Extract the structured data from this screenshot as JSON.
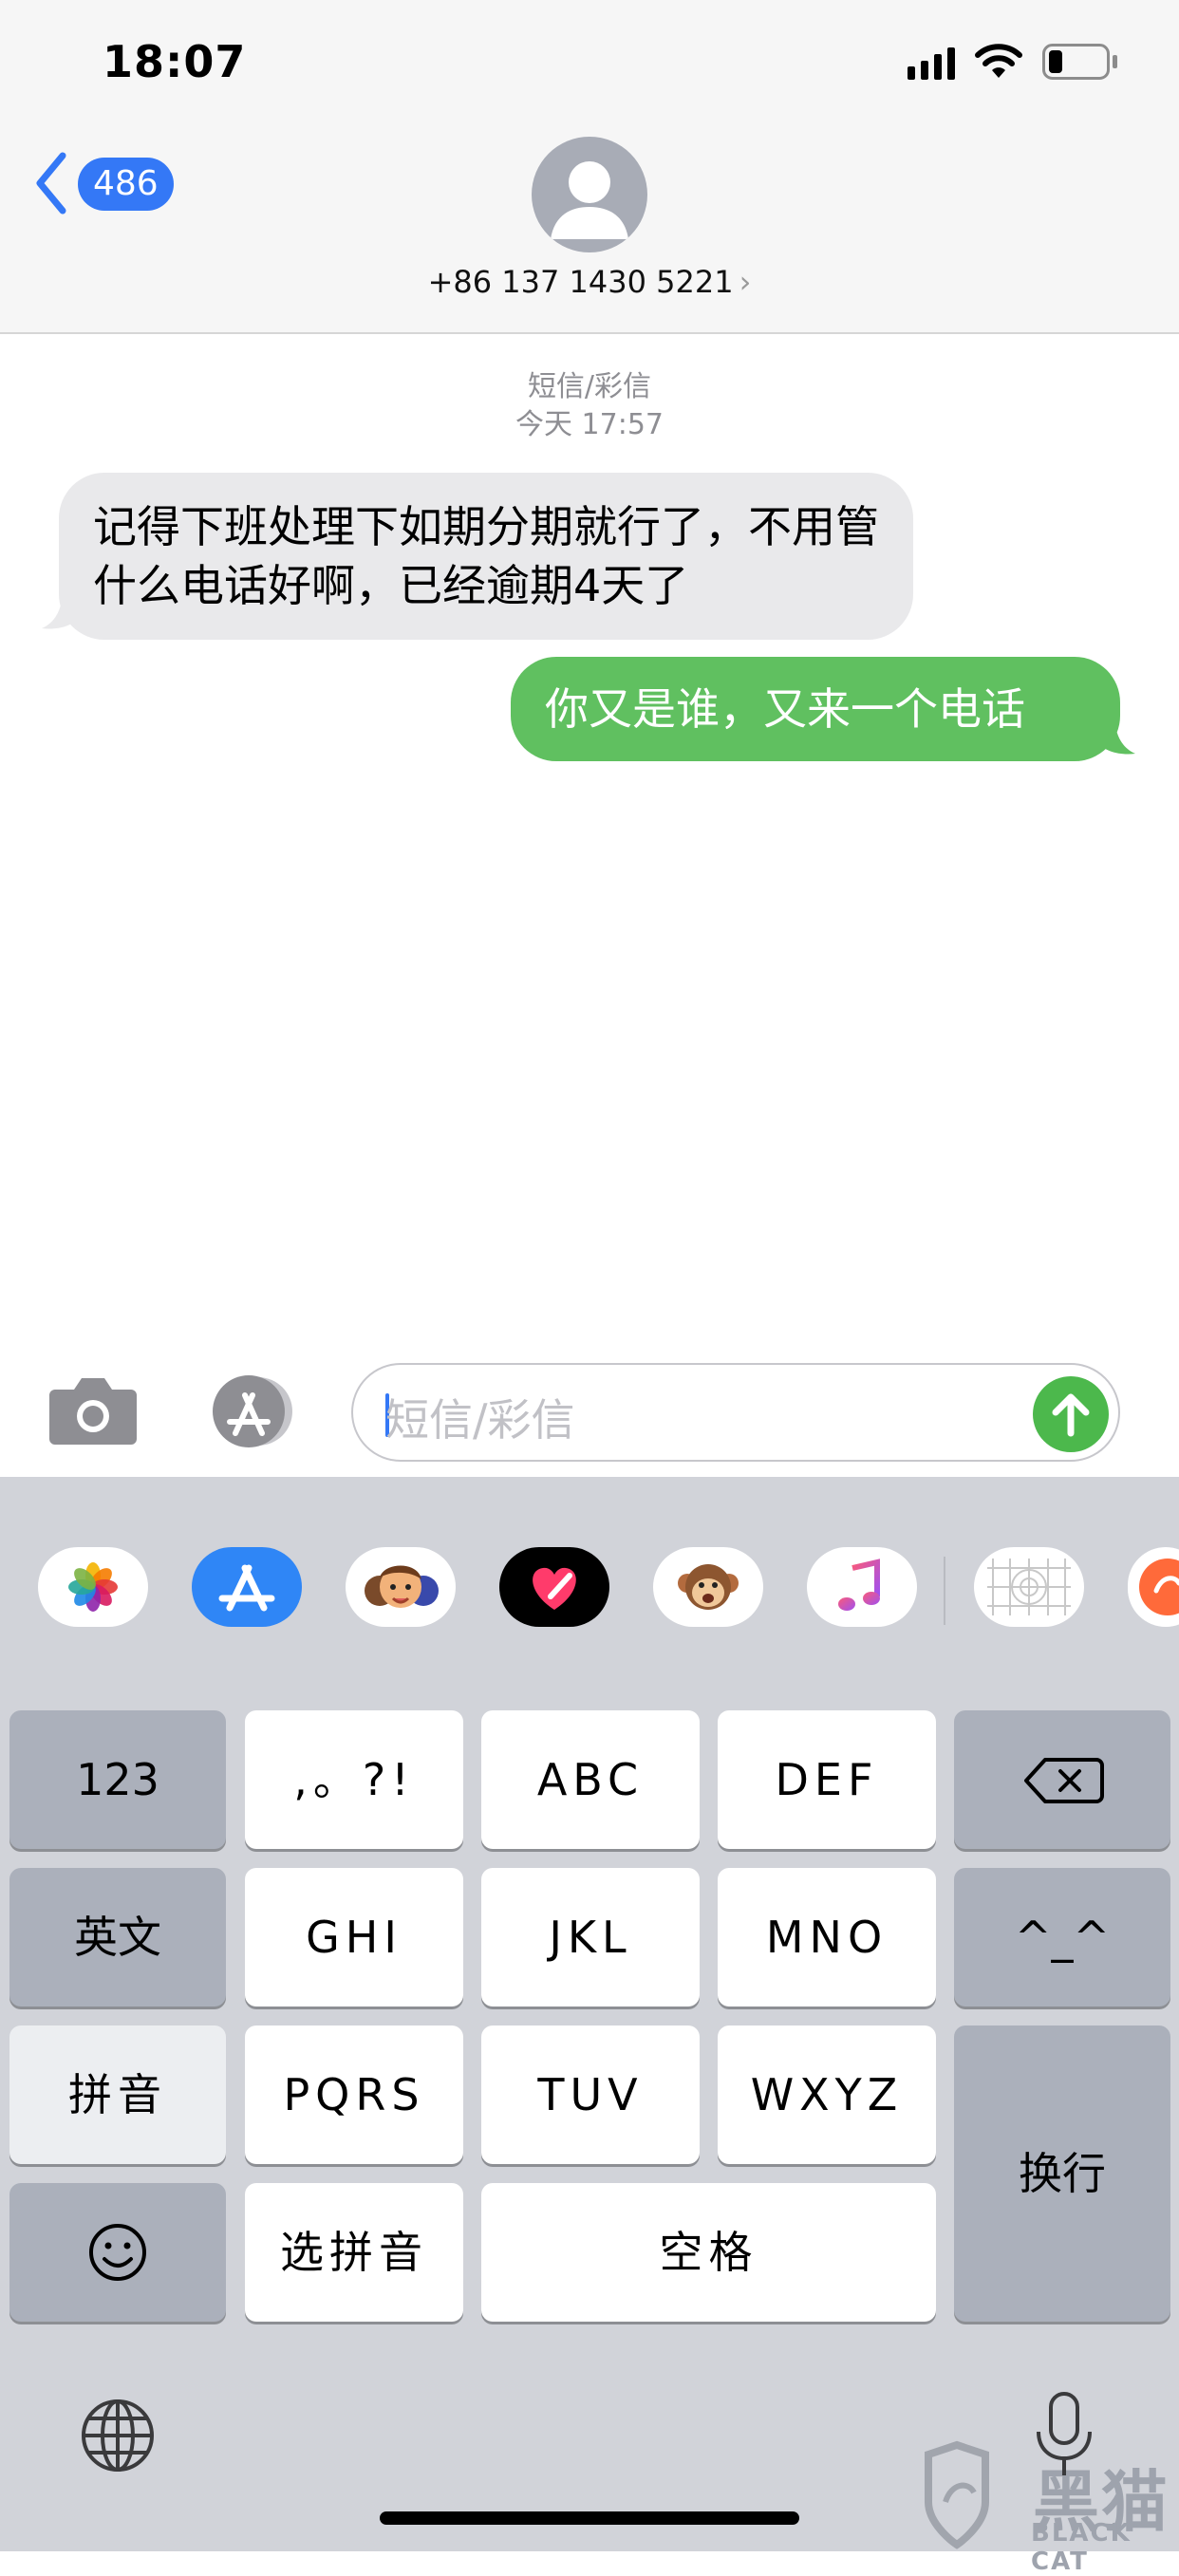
{
  "status_bar": {
    "time": "18:07"
  },
  "nav": {
    "back_badge": "486",
    "contact": "+86 137 1430 5221",
    "contact_chevron": "›"
  },
  "thread": {
    "service": "短信/彩信",
    "timestamp": "今天 17:57",
    "messages": [
      {
        "direction": "incoming",
        "text": "记得下班处理下如期分期就行了，不用管什么电话好啊，已经逾期4天了"
      },
      {
        "direction": "outgoing",
        "text": "你又是谁，又来一个电话"
      }
    ]
  },
  "composer": {
    "placeholder": "短信/彩信",
    "icons": [
      "camera-icon",
      "app-store-icon",
      "send-arrow-icon"
    ]
  },
  "app_drawer": {
    "icons": [
      "photos-icon",
      "app-store-icon",
      "memoji-stickers-icon",
      "digital-touch-icon",
      "animoji-icon",
      "music-icon",
      "sticker-app-icon",
      "partial-app-icon"
    ]
  },
  "keyboard": {
    "rows": [
      [
        "123",
        ",。?!",
        "ABC",
        "DEF",
        "⌫"
      ],
      [
        "英文",
        "GHI",
        "JKL",
        "MNO",
        "^_^"
      ],
      [
        "拼音",
        "PQRS",
        "TUV",
        "WXYZ",
        "换行"
      ],
      [
        "☺",
        "选拼音",
        "空格"
      ]
    ],
    "k123": "123",
    "kpunct": ",。?!",
    "kabc": "ABC",
    "kdef": "DEF",
    "kenglish": "英文",
    "kghi": "GHI",
    "kjkl": "JKL",
    "kmno": "MNO",
    "kface": "^_^",
    "kpinyin": "拼音",
    "kpqrs": "PQRS",
    "ktuv": "TUV",
    "kwxyz": "WXYZ",
    "kreturn": "换行",
    "kselect": "选拼音",
    "kspace": "空格"
  },
  "watermark": {
    "text": "黑猫",
    "sub": "BLACK CAT"
  },
  "colors": {
    "accent": "#3478f6",
    "outgoing_bubble": "#60c060",
    "incoming_bubble": "#e9e9eb",
    "keyboard_bg": "#d1d3d9",
    "function_key": "#abb0bb"
  }
}
